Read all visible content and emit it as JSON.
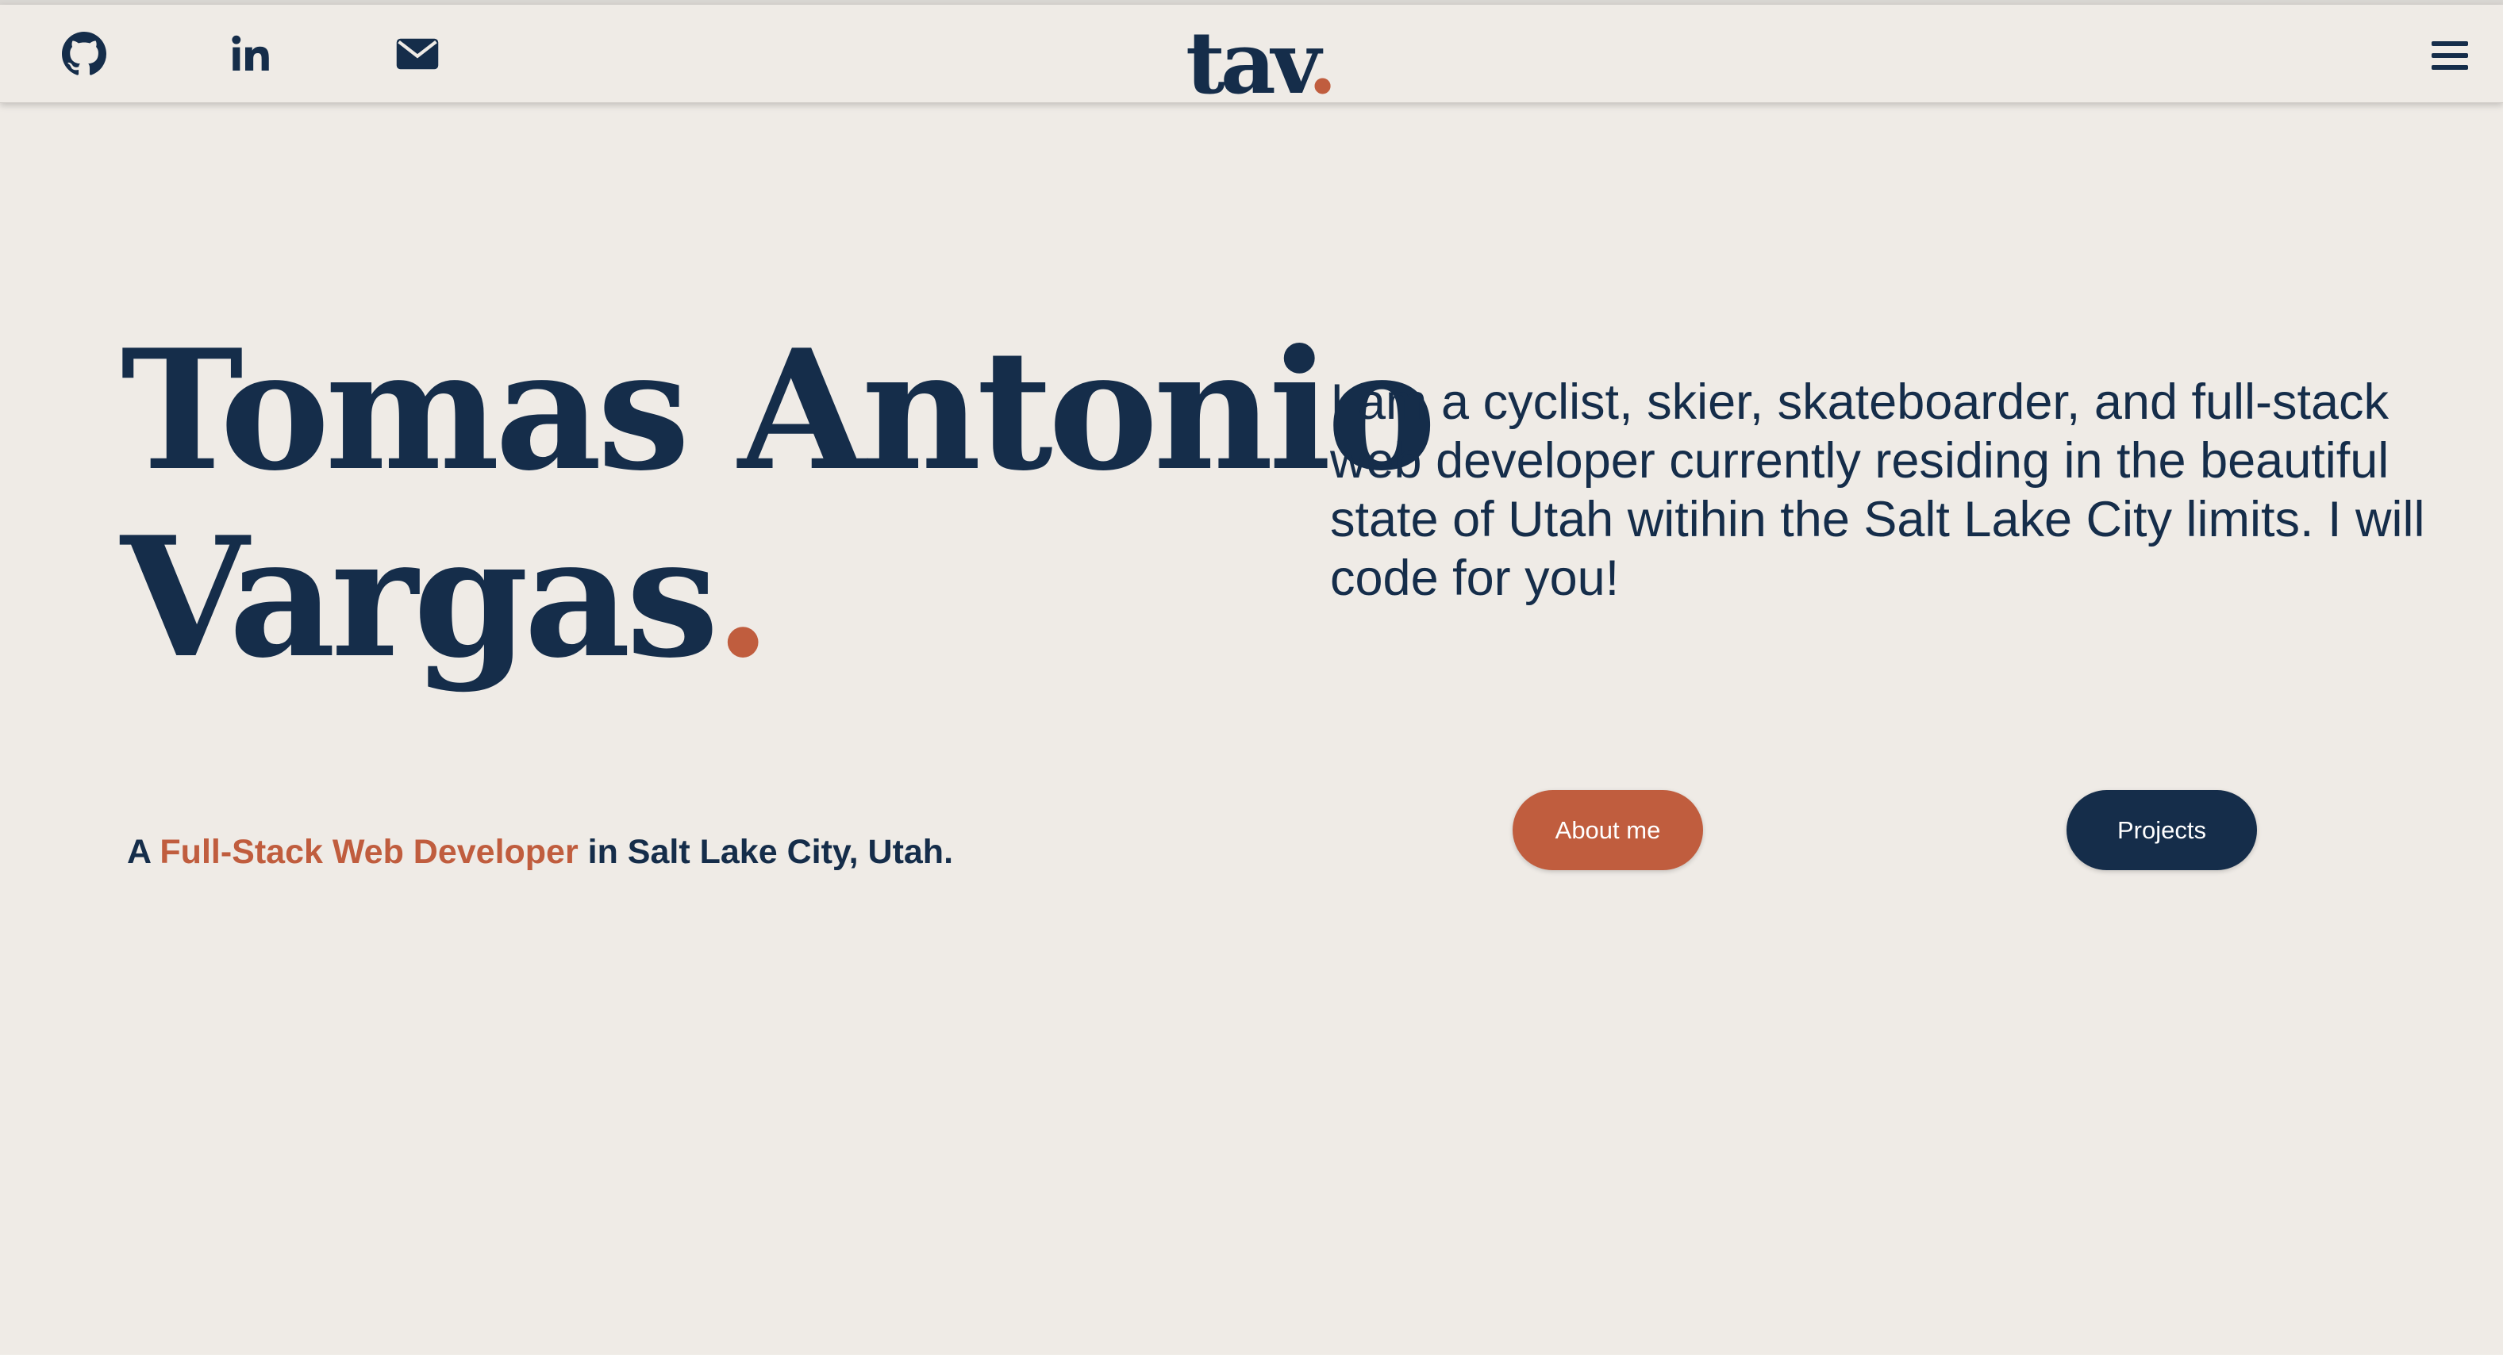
{
  "header": {
    "social": [
      {
        "icon": "github-icon",
        "name": "github-link"
      },
      {
        "icon": "linkedin-icon",
        "name": "linkedin-link"
      },
      {
        "icon": "envelope-icon",
        "name": "email-link"
      }
    ],
    "logo_text": "tav",
    "logo_dot": ".",
    "menu_icon": "hamburger-menu-icon"
  },
  "hero": {
    "name_line1": "Tomas Antonio",
    "name_line2": "Vargas",
    "name_dot": ".",
    "intro": "I am a cyclist, skier, skateboarder, and full-stack web developer currently residing in the beautiful state of Utah witihin the Salt Lake City limits. I will code for you!",
    "tagline_prefix": "A ",
    "tagline_accent": "Full-Stack Web Developer",
    "tagline_suffix": " in Salt Lake City, Utah."
  },
  "buttons": {
    "about": "About me",
    "projects": "Projects"
  },
  "colors": {
    "background": "#efebe6",
    "navy": "#152d4a",
    "accent": "#c05d3e"
  }
}
